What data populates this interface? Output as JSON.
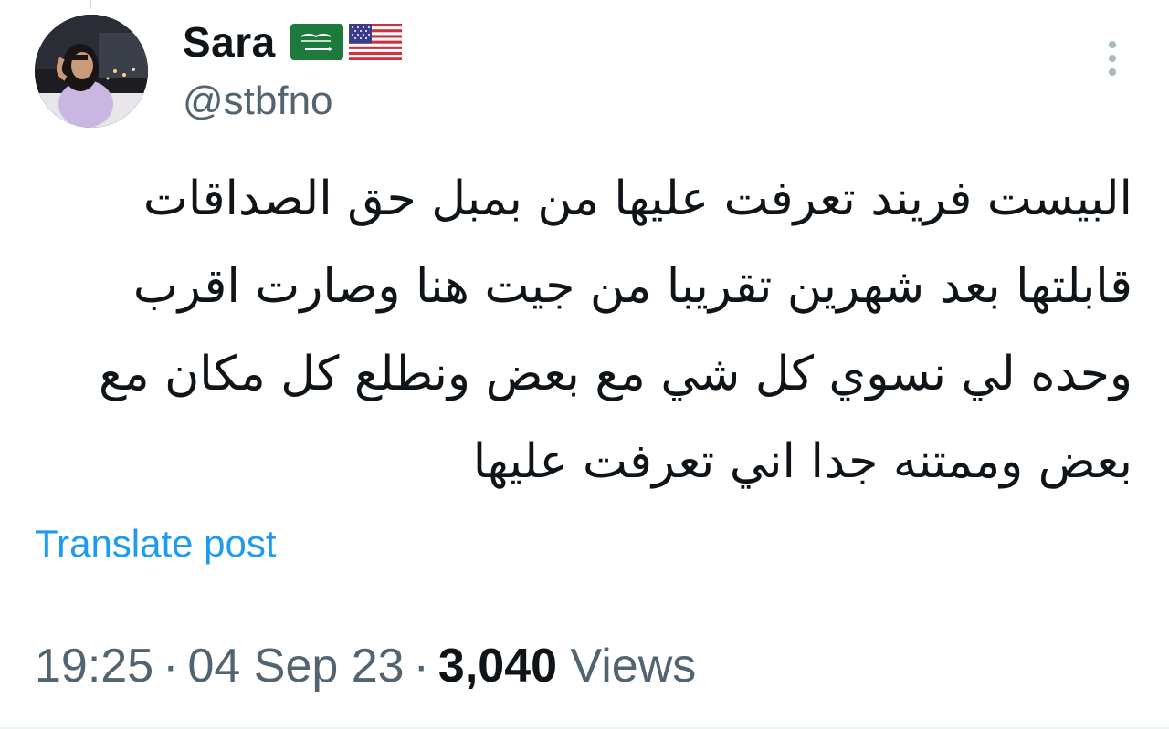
{
  "author": {
    "display_name": "Sara",
    "handle": "@stbfno",
    "flags": [
      "saudi-arabia-flag",
      "usa-flag"
    ]
  },
  "tweet": {
    "lines": [
      "البيست فريند تعرفت عليها من بمبل حق الصداقات",
      "قابلتها بعد شهرين تقريبا من جيت هنا وصارت اقرب",
      "وحده لي نسوي كل شي مع بعض ونطلع كل مكان مع",
      "بعض وممتنه جدا اني تعرفت عليها"
    ],
    "translate_label": "Translate post"
  },
  "meta": {
    "time": "19:25",
    "date": "04 Sep 23",
    "separator": "·",
    "views_count": "3,040",
    "views_label": "Views"
  },
  "colors": {
    "link": "#1d9bf0",
    "secondary_text": "#536471",
    "primary_text": "#0f1419"
  }
}
